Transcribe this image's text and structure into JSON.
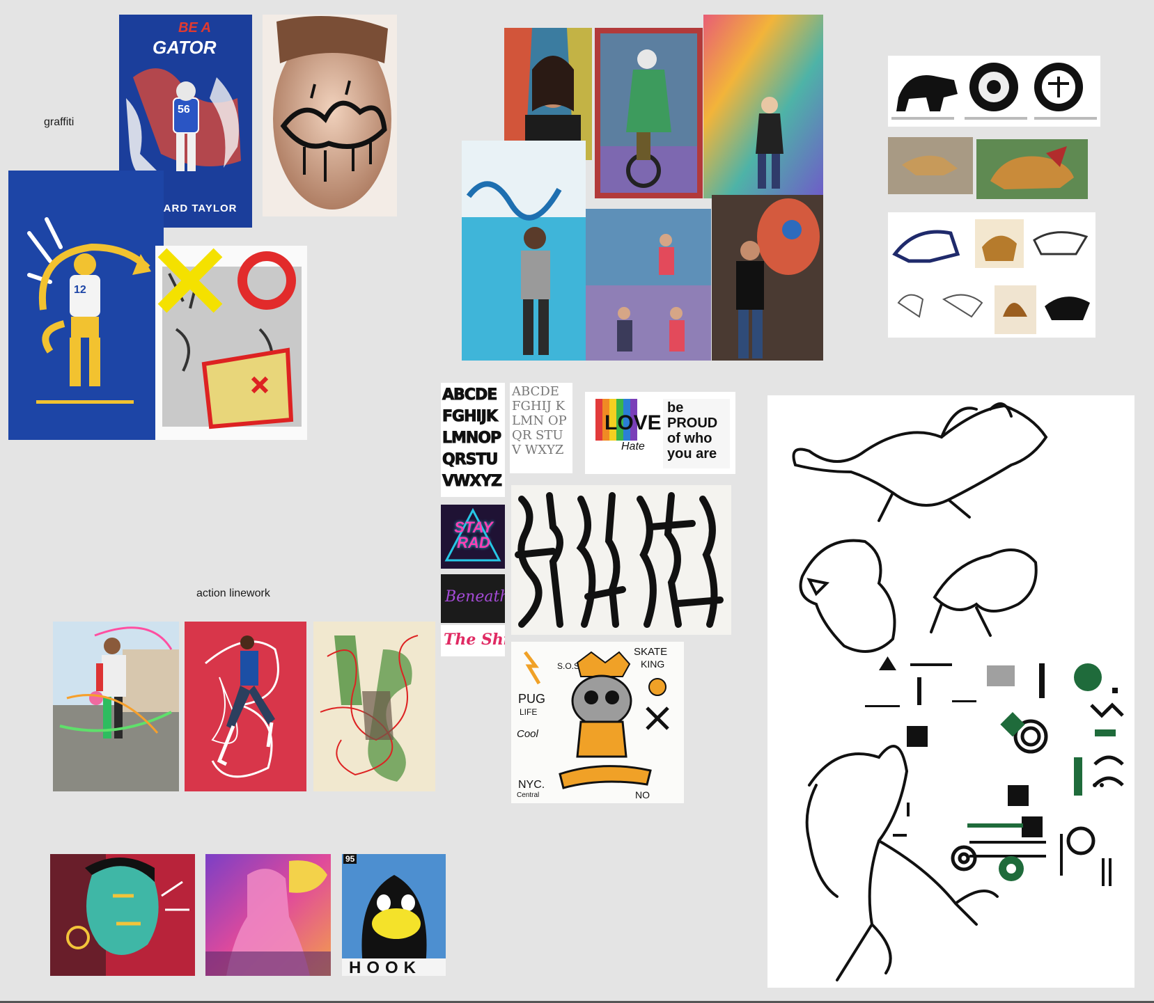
{
  "board": {
    "labels": {
      "graffiti": "graffiti",
      "action_linework": "action linework"
    }
  },
  "tiles": {
    "gator_poster": {
      "title_top": "BE A",
      "title_main": "GATOR",
      "jersey_number": "56",
      "footer_name": "LEONARD TAYLOR"
    },
    "rams_poster": {
      "jersey_number": "12"
    },
    "lettering": {
      "alphabet_bold": "ABCDE FGHIJK LMNOP QRSTU VWXYZ",
      "alphabet_thin": "ABCDE FGHIJ KLMN OPQR STUV WXYZ",
      "love_text": "LOVE",
      "hate_text": "Hate",
      "proud_text": "be PROUD of who you are",
      "stay_rad": "STAY RAD",
      "script_1": "Beneath",
      "script_2": "The Shit"
    },
    "pug_sticker": {
      "skate": "SKATE",
      "king": "KING",
      "pug": "PUG",
      "life": "LIFE",
      "cool": "Cool",
      "nyc": "NYC.",
      "central": "Central",
      "sos": "S.O.S",
      "no": "NO"
    },
    "hook_poster": {
      "number": "95",
      "word": "HOOK"
    }
  },
  "colors": {
    "background": "#e4e4e4",
    "gator_blue": "#1b3e9b",
    "rams_blue": "#1d45a6",
    "rams_yellow": "#f2c230",
    "nike_red": "#d8364a",
    "ink": "#111111",
    "accent_green": "#1f6b3b"
  }
}
